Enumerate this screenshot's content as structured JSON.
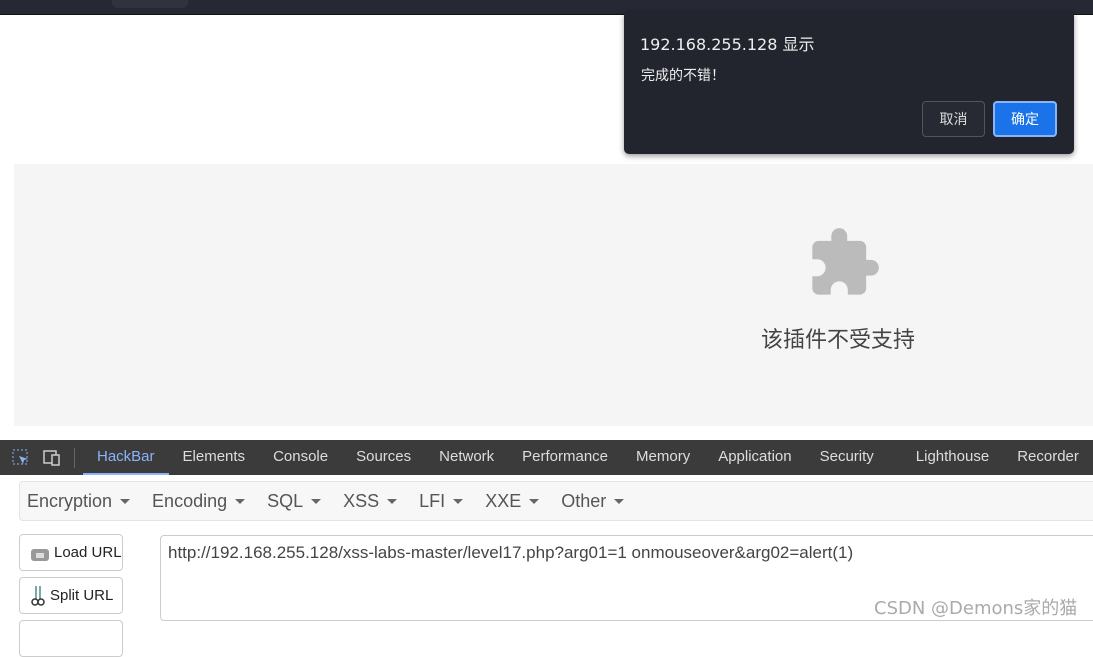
{
  "dialog": {
    "title": "192.168.255.128 显示",
    "message": "完成的不错！",
    "cancel": "取消",
    "ok": "确定"
  },
  "plugin": {
    "message": "该插件不受支持"
  },
  "devtools": {
    "tabs": [
      "HackBar",
      "Elements",
      "Console",
      "Sources",
      "Network",
      "Performance",
      "Memory",
      "Application",
      "Security",
      "Lighthouse",
      "Recorder"
    ]
  },
  "hackbar": {
    "menus": [
      "Encryption",
      "Encoding",
      "SQL",
      "XSS",
      "LFI",
      "XXE",
      "Other"
    ],
    "load_url": "Load URL",
    "split_url": "Split URL",
    "url_value": "http://192.168.255.128/xss-labs-master/level17.php?arg01=1  onmouseover&arg02=alert(1)"
  },
  "watermark": "CSDN @Demons家的猫"
}
